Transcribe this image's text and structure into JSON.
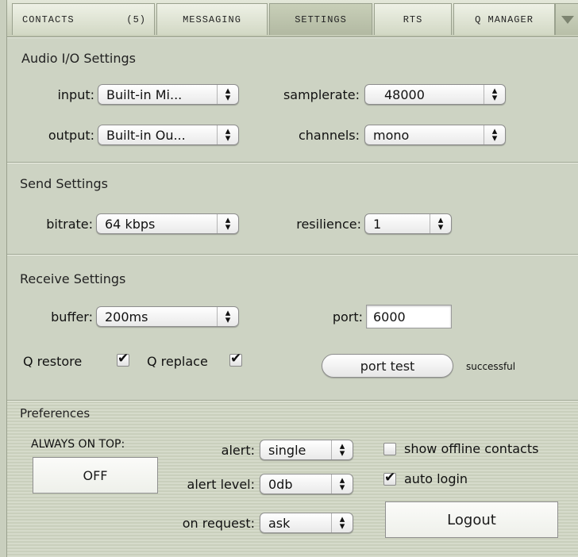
{
  "tabs": {
    "contacts": "CONTACTS",
    "contacts_count": "(5)",
    "messaging": "MESSAGING",
    "settings": "SETTINGS",
    "rts": "RTS",
    "qmanager": "Q MANAGER",
    "more_icon": "triangle-down-icon"
  },
  "audio": {
    "title": "Audio I/O Settings",
    "input_label": "input:",
    "input_value": "Built-in Mi...",
    "samplerate_label": "samplerate:",
    "samplerate_value": "48000",
    "output_label": "output:",
    "output_value": "Built-in Ou...",
    "channels_label": "channels:",
    "channels_value": "mono"
  },
  "send": {
    "title": "Send Settings",
    "bitrate_label": "bitrate:",
    "bitrate_value": "64 kbps",
    "resilience_label": "resilience:",
    "resilience_value": "1"
  },
  "receive": {
    "title": "Receive Settings",
    "buffer_label": "buffer:",
    "buffer_value": "200ms",
    "port_label": "port:",
    "port_value": "6000",
    "q_restore_label": "Q restore",
    "q_replace_label": "Q replace",
    "port_test_label": "port test",
    "port_test_status": "successful"
  },
  "prefs": {
    "title": "Preferences",
    "always_on_top_label": "ALWAYS ON TOP:",
    "always_on_top_button": "OFF",
    "alert_label": "alert:",
    "alert_value": "single",
    "alert_level_label": "alert level:",
    "alert_level_value": "0db",
    "on_request_label": "on request:",
    "on_request_value": "ask",
    "show_offline_label": "show offline contacts",
    "auto_login_label": "auto login",
    "logout_label": "Logout"
  },
  "stepper_glyph": "⬍"
}
